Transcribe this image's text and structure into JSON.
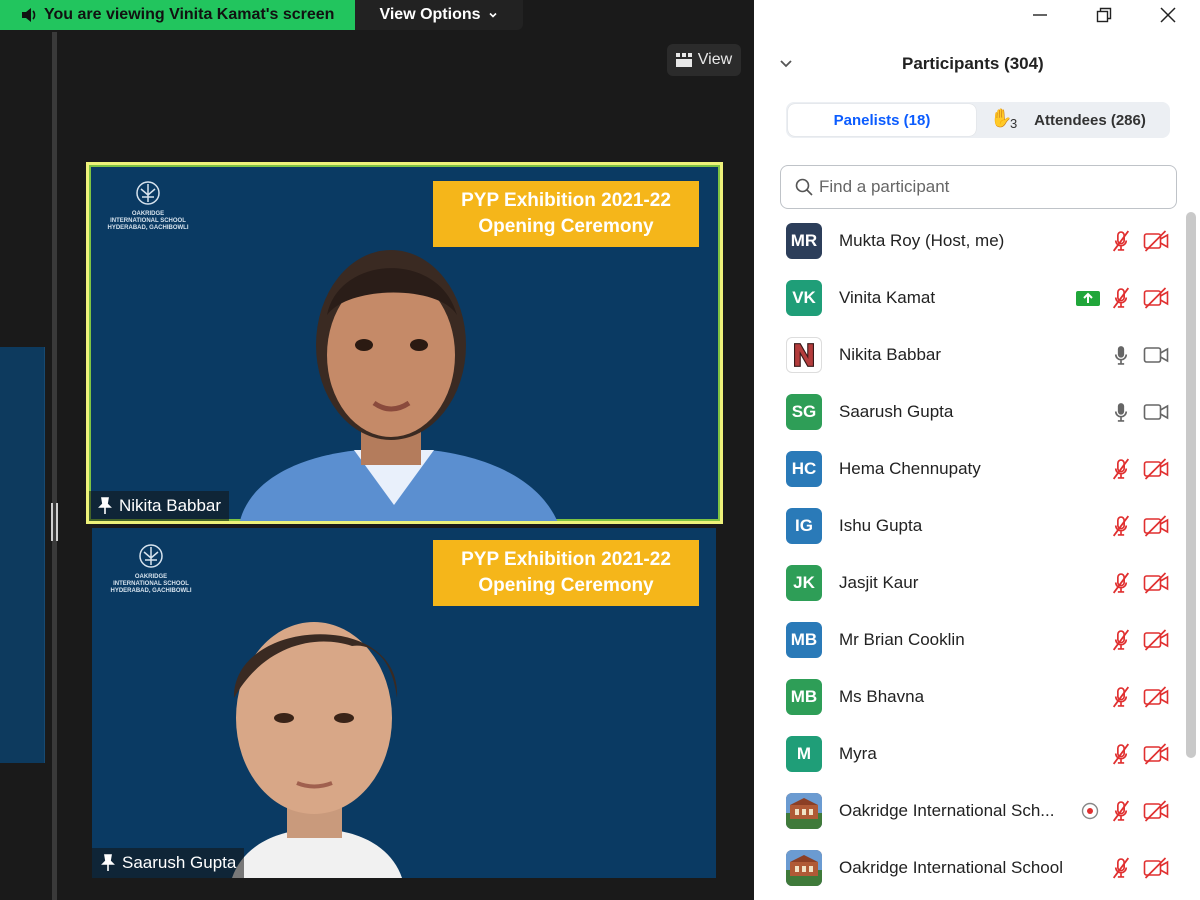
{
  "share_banner": {
    "text": "You are viewing Vinita Kamat's screen",
    "color": "#22c55e"
  },
  "view_options": {
    "label": "View Options"
  },
  "view_button": {
    "label": "View"
  },
  "tiles": [
    {
      "name": "Nikita Babbar",
      "banner_line1": "PYP Exhibition 2021-22",
      "banner_line2": "Opening Ceremony",
      "active_speaker": true
    },
    {
      "name": "Saarush Gupta",
      "banner_line1": "PYP Exhibition 2021-22",
      "banner_line2": "Opening Ceremony",
      "active_speaker": false
    }
  ],
  "school_logo": {
    "line1": "OAKRIDGE",
    "line2": "INTERNATIONAL SCHOOL",
    "line3": "HYDERABAD, GACHIBOWLI"
  },
  "panel": {
    "title": "Participants (304)",
    "tabs": {
      "panelists": "Panelists (18)",
      "attendees": "Attendees (286)",
      "raised_hands": "3"
    },
    "search_placeholder": "Find a participant",
    "participants": [
      {
        "initials": "MR",
        "name": "Mukta Roy (Host, me)",
        "color": "#2c3e5a",
        "mic": "muted",
        "cam": "off"
      },
      {
        "initials": "VK",
        "name": "Vinita Kamat",
        "color": "#1f9e78",
        "mic": "muted",
        "cam": "off",
        "sharing": true
      },
      {
        "initials": "N",
        "name": "Nikita Babbar",
        "color": "#ffffff",
        "mic": "on",
        "cam": "on",
        "picture": "letter-n"
      },
      {
        "initials": "SG",
        "name": "Saarush Gupta",
        "color": "#2e9e57",
        "mic": "on",
        "cam": "on"
      },
      {
        "initials": "HC",
        "name": "Hema Chennupaty",
        "color": "#2a7ab8",
        "mic": "muted",
        "cam": "off"
      },
      {
        "initials": "IG",
        "name": "Ishu Gupta",
        "color": "#2a7ab8",
        "mic": "muted",
        "cam": "off"
      },
      {
        "initials": "JK",
        "name": "Jasjit Kaur",
        "color": "#2e9e57",
        "mic": "muted",
        "cam": "off"
      },
      {
        "initials": "MB",
        "name": "Mr Brian Cooklin",
        "color": "#2a7ab8",
        "mic": "muted",
        "cam": "off"
      },
      {
        "initials": "MB",
        "name": "Ms Bhavna",
        "color": "#2e9e57",
        "mic": "muted",
        "cam": "off"
      },
      {
        "initials": "M",
        "name": "Myra",
        "color": "#1f9e78",
        "mic": "muted",
        "cam": "off"
      },
      {
        "initials": "",
        "name": "Oakridge International Sch...",
        "color": "#8a5a3a",
        "mic": "muted",
        "cam": "off",
        "recording": true,
        "picture": "building"
      },
      {
        "initials": "",
        "name": "Oakridge International School",
        "color": "#8a5a3a",
        "mic": "muted",
        "cam": "off",
        "picture": "building"
      }
    ]
  },
  "colors": {
    "muted_red": "#e02f2f",
    "accent_blue": "#0b5cff",
    "speaker_yellow": "#eef27a",
    "slide_blue": "#0a3a63",
    "banner_gold": "#f5b61a"
  },
  "icons": [
    "speaker-icon",
    "chevron-down-icon",
    "gallery-icon",
    "pin-icon",
    "minimize-icon",
    "restore-icon",
    "close-icon",
    "search-icon",
    "raised-hand-icon",
    "mic-muted-icon",
    "camera-off-icon",
    "mic-icon",
    "camera-icon",
    "share-screen-icon",
    "record-icon"
  ]
}
